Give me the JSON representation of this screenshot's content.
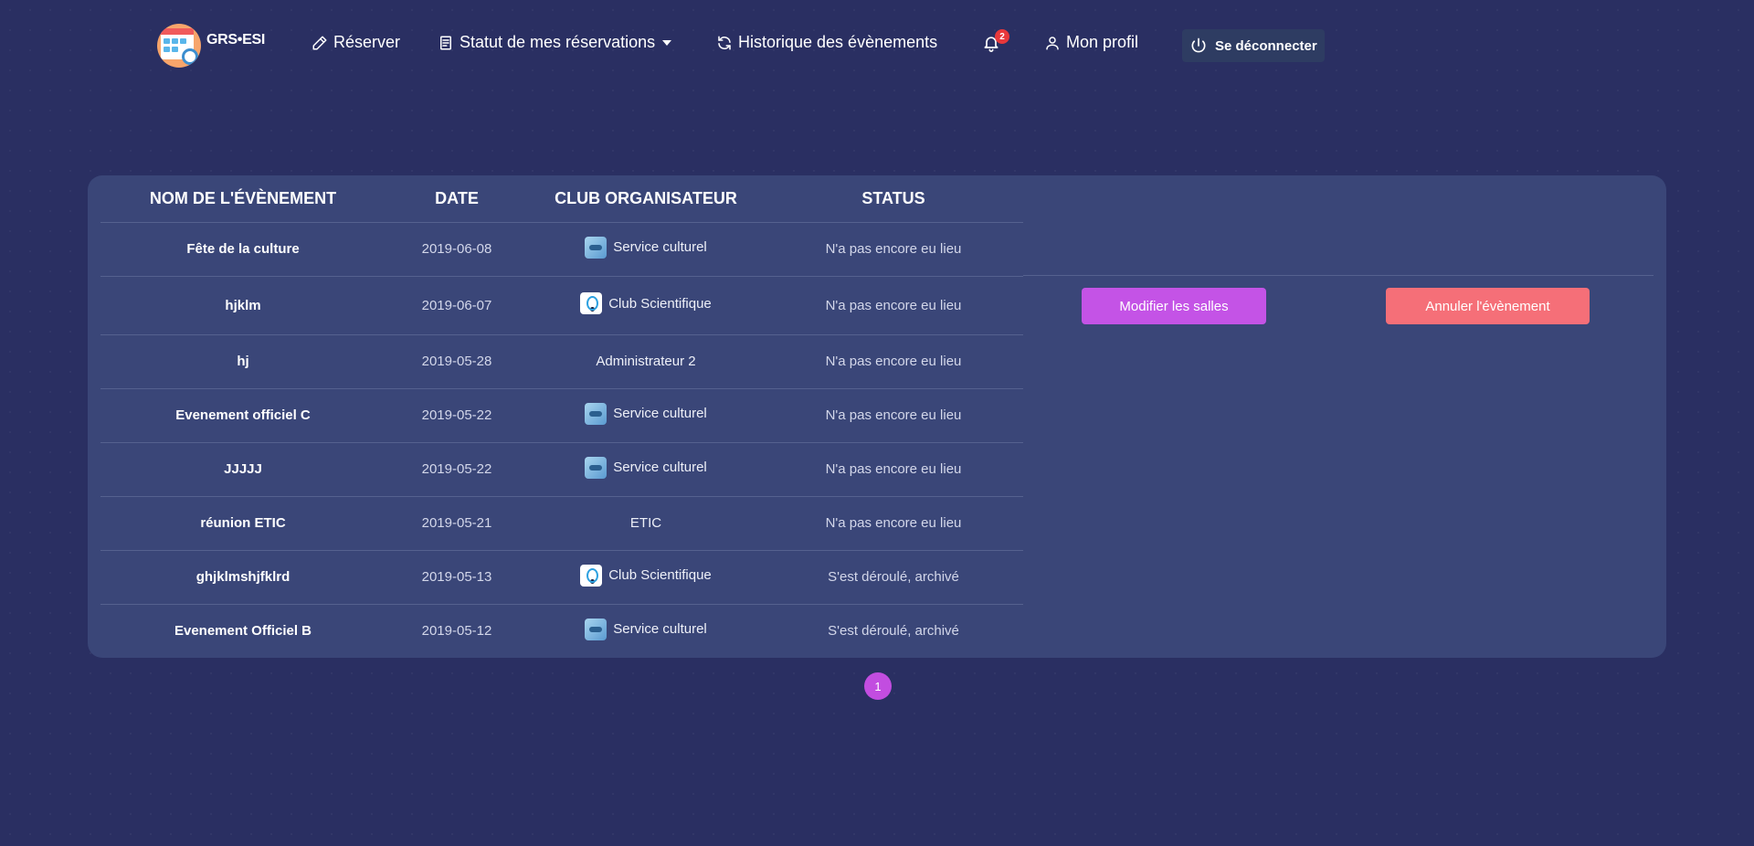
{
  "brand": {
    "name": "GRS•ESI"
  },
  "nav": {
    "reserve": "Réserver",
    "status": "Statut de mes réservations",
    "history": "Historique des évènements",
    "notifications_count": "2",
    "profile": "Mon profil",
    "logout": "Se déconnecter"
  },
  "table": {
    "headers": [
      "NOM DE L'ÉVÈNEMENT",
      "DATE",
      "CLUB ORGANISATEUR",
      "STATUS"
    ],
    "rows": [
      {
        "name": "Fête de la culture",
        "date": "2019-06-08",
        "club": "Service culturel",
        "club_icon": "culture-club-icon",
        "status": "N'a pas encore eu lieu"
      },
      {
        "name": "hjklm",
        "date": "2019-06-07",
        "club": "Club Scientifique",
        "club_icon": "science-club-icon",
        "status": "N'a pas encore eu lieu"
      },
      {
        "name": "hj",
        "date": "2019-05-28",
        "club": "Administrateur 2",
        "club_icon": "",
        "status": "N'a pas encore eu lieu"
      },
      {
        "name": "Evenement officiel C",
        "date": "2019-05-22",
        "club": "Service culturel",
        "club_icon": "culture-club-icon",
        "status": "N'a pas encore eu lieu"
      },
      {
        "name": "JJJJJ",
        "date": "2019-05-22",
        "club": "Service culturel",
        "club_icon": "culture-club-icon",
        "status": "N'a pas encore eu lieu"
      },
      {
        "name": "réunion ETIC",
        "date": "2019-05-21",
        "club": "ETIC",
        "club_icon": "",
        "status": "N'a pas encore eu lieu"
      },
      {
        "name": "ghjklmshjfklrd",
        "date": "2019-05-13",
        "club": "Club Scientifique",
        "club_icon": "science-club-icon",
        "status": "S'est déroulé, archivé"
      },
      {
        "name": "Evenement Officiel B",
        "date": "2019-05-12",
        "club": "Service culturel",
        "club_icon": "culture-club-icon",
        "status": "S'est déroulé, archivé"
      }
    ]
  },
  "actions": {
    "modify_rooms": "Modifier les salles",
    "cancel_event": "Annuler l'évènement"
  },
  "pagination": {
    "current_page": "1"
  },
  "colors": {
    "background": "#2a2f62",
    "panel": "#3a4678",
    "modify_button": "#c453e6",
    "cancel_button": "#f56f78",
    "badge": "#e8383b"
  }
}
